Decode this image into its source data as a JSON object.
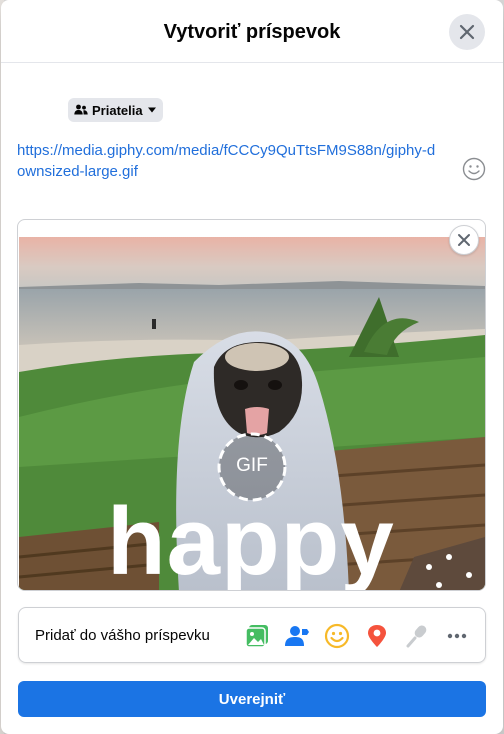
{
  "dialog": {
    "title": "Vytvoriť príspevok",
    "close_icon": "close-icon"
  },
  "privacy": {
    "label": "Priatelia",
    "icon": "friends-icon",
    "caret_icon": "caret-down-icon"
  },
  "composer": {
    "text": "https://media.giphy.com/media/fCCCy9QuTtsFM9S88n/giphy-downsized-large.gif",
    "emoji_icon": "smiley-icon"
  },
  "preview": {
    "badge": "GIF",
    "caption": "happy",
    "remove_icon": "close-icon"
  },
  "add_to_post": {
    "label": "Pridať do vášho príspevku",
    "icons": [
      "photo-video-icon",
      "tag-people-icon",
      "feeling-icon",
      "check-in-icon",
      "live-video-icon",
      "more-icon"
    ]
  },
  "publish": {
    "label": "Uverejniť"
  },
  "colors": {
    "accent": "#1b74e4",
    "link": "#216fdb",
    "green": "#45bd62",
    "yellow": "#f7b928",
    "red": "#f5533d"
  }
}
